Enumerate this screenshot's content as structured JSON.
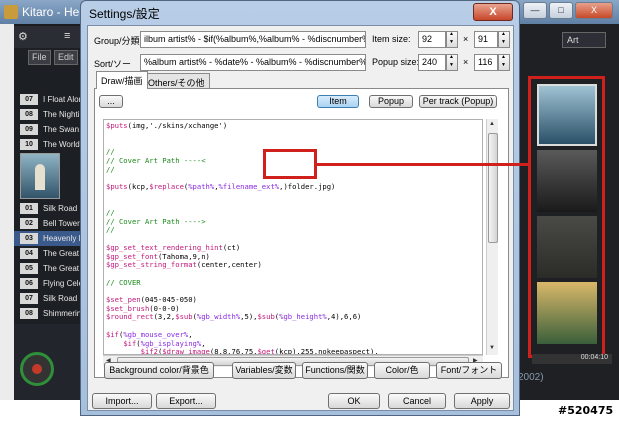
{
  "player": {
    "title": "Kitaro - Hea",
    "win_buttons": [
      "—",
      "□",
      "X"
    ],
    "toolbar_left": "⚙",
    "toolbar_right": "≡",
    "tab_file": "File",
    "tab_edit": "Edit",
    "playlist": [
      {
        "num": "07",
        "title": "I Float Alon"
      },
      {
        "num": "08",
        "title": "The Nightin"
      },
      {
        "num": "09",
        "title": "The Swan"
      },
      {
        "num": "10",
        "title": "The World"
      },
      {
        "num": "01",
        "title": "Silk Road (F"
      },
      {
        "num": "02",
        "title": "Bell Tower"
      },
      {
        "num": "03",
        "title": "Heavenly F",
        "selected": true
      },
      {
        "num": "04",
        "title": "The Great"
      },
      {
        "num": "05",
        "title": "The Great"
      },
      {
        "num": "06",
        "title": "Flying Cele"
      },
      {
        "num": "07",
        "title": "Silk Road F"
      },
      {
        "num": "08",
        "title": "Shimmering"
      }
    ],
    "right_art_label": "Art",
    "time": "00:04:10",
    "year": "2002)"
  },
  "dialog": {
    "title": "Settings/設定",
    "close_label": "X",
    "group_label": "Group/分類:",
    "group_value": "ilbum artist% - $if(%album%,%album% - %discnumber%,@skip)",
    "sort_label": "Sort/ソー",
    "sort_value": "%album artist% - %date% - %album% - %discnumber%",
    "item_size_label": "Item size:",
    "item_size_w": "92",
    "item_size_h": "91",
    "popup_size_label": "Popup size:",
    "popup_size_w": "240",
    "popup_size_h": "116",
    "times": "×",
    "tabs": [
      "Draw/描画",
      "Others/その他"
    ],
    "dots_button": "...",
    "mode_buttons": [
      "Item",
      "Popup",
      "Per track (Popup)"
    ],
    "bottom_buttons": [
      "Background color/背景色",
      "Variables/変数",
      "Functions/関数",
      "Color/色",
      "Font/フォント"
    ],
    "footer_buttons": [
      "Import...",
      "Export...",
      "OK",
      "Cancel",
      "Apply"
    ],
    "code_lines": [
      "$puts(img,'./skins/xchange')",
      "",
      "",
      "//",
      "// Cover Art Path ----<",
      "//",
      "",
      "$puts(kcp,$replace(%path%,%filename_ext%,)folder.jpg)",
      "",
      "",
      "//",
      "// Cover Art Path ---->",
      "//",
      "",
      "$gp_set_text_rendering_hint(ct)",
      "$gp_set_font(Tahoma,9,n)",
      "$gp_set_string_format(center,center)",
      "",
      "// COVER",
      "",
      "$set_pen(045-045-050)",
      "$set_brush(0-0-0)",
      "$round_rect(3,2,$sub(%gb_width%,5),$sub(%gb_height%,4),6,6)",
      "",
      "$if(%gb_mouse_over%,",
      "    $if(%gb_isplaying%,",
      "        $if2($draw_image(8,8,76,75,$get(kcp),255,nokeepaspect),",
      "            $gp_set_font(Tahoma,8,n)"
    ]
  },
  "watermark": "#520475"
}
